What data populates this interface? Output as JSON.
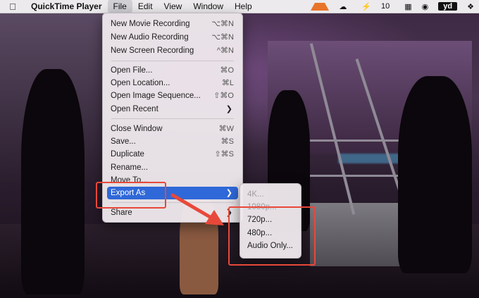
{
  "menubar": {
    "app_name": "QuickTime Player",
    "menus": [
      "File",
      "Edit",
      "View",
      "Window",
      "Help"
    ],
    "status": {
      "battery": "10"
    }
  },
  "file_menu": {
    "items": [
      {
        "label": "New Movie Recording",
        "shortcut": "⌥⌘N"
      },
      {
        "label": "New Audio Recording",
        "shortcut": "⌥⌘N"
      },
      {
        "label": "New Screen Recording",
        "shortcut": "^⌘N"
      },
      {
        "label": "Open File...",
        "shortcut": "⌘O"
      },
      {
        "label": "Open Location...",
        "shortcut": "⌘L"
      },
      {
        "label": "Open Image Sequence...",
        "shortcut": "⇧⌘O"
      },
      {
        "label": "Open Recent",
        "shortcut": ""
      },
      {
        "label": "Close Window",
        "shortcut": "⌘W"
      },
      {
        "label": "Save...",
        "shortcut": "⌘S"
      },
      {
        "label": "Duplicate",
        "shortcut": "⇧⌘S"
      },
      {
        "label": "Rename...",
        "shortcut": ""
      },
      {
        "label": "Move To...",
        "shortcut": ""
      },
      {
        "label": "Export As",
        "shortcut": ""
      },
      {
        "label": "Share",
        "shortcut": ""
      }
    ]
  },
  "export_submenu": {
    "items": [
      {
        "label": "4K...",
        "enabled": false
      },
      {
        "label": "1080p...",
        "enabled": false
      },
      {
        "label": "720p...",
        "enabled": true
      },
      {
        "label": "480p...",
        "enabled": true
      },
      {
        "label": "Audio Only...",
        "enabled": true
      }
    ]
  },
  "colors": {
    "selection": "#2f68d8",
    "annotation": "#e8483a"
  }
}
